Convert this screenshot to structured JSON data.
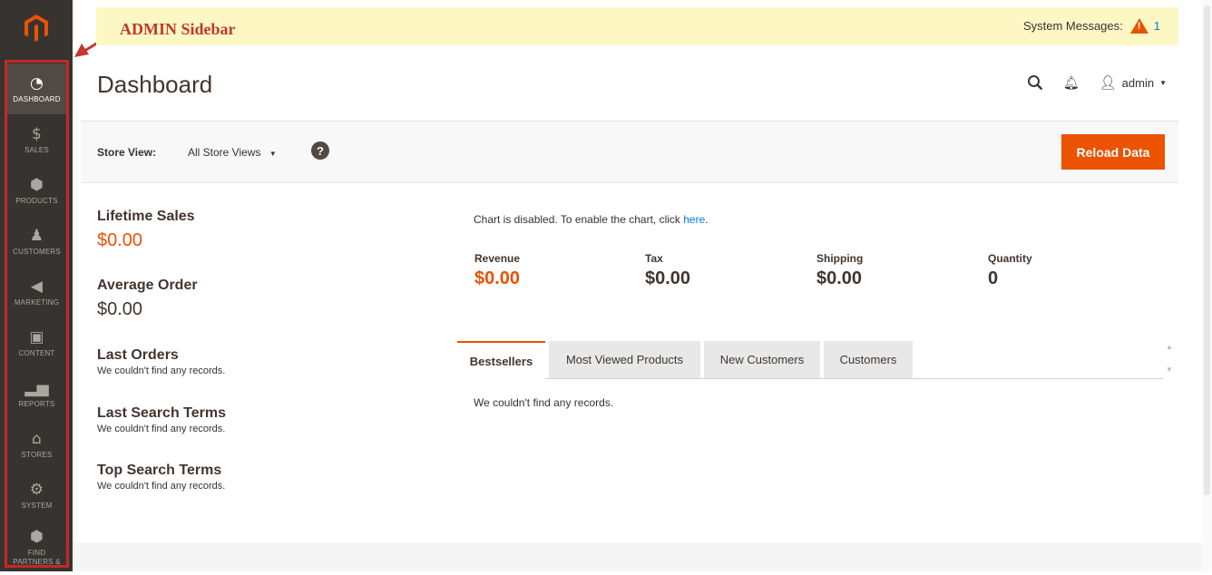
{
  "annotation": {
    "label": "ADMIN Sidebar"
  },
  "system_messages": {
    "label": "System Messages:",
    "count": "1"
  },
  "page_title": "Dashboard",
  "header": {
    "user": "admin"
  },
  "sidebar": {
    "items": [
      {
        "label": "DASHBOARD",
        "icon": "dashboard-gauge-icon",
        "active": true
      },
      {
        "label": "SALES",
        "icon": "dollar-icon"
      },
      {
        "label": "PRODUCTS",
        "icon": "box-icon"
      },
      {
        "label": "CUSTOMERS",
        "icon": "person-icon"
      },
      {
        "label": "MARKETING",
        "icon": "megaphone-icon"
      },
      {
        "label": "CONTENT",
        "icon": "content-layout-icon"
      },
      {
        "label": "REPORTS",
        "icon": "bar-chart-icon"
      },
      {
        "label": "STORES",
        "icon": "storefront-icon"
      },
      {
        "label": "SYSTEM",
        "icon": "gear-icon"
      },
      {
        "label": "FIND PARTNERS &",
        "icon": "partners-box-icon"
      }
    ]
  },
  "store_view": {
    "label": "Store View:",
    "value": "All Store Views"
  },
  "reload_button": "Reload Data",
  "lifetime_sales": {
    "label": "Lifetime Sales",
    "value": "$0.00"
  },
  "average_order": {
    "label": "Average Order",
    "value": "$0.00"
  },
  "last_orders": {
    "title": "Last Orders",
    "empty": "We couldn't find any records."
  },
  "last_search_terms": {
    "title": "Last Search Terms",
    "empty": "We couldn't find any records."
  },
  "top_search_terms": {
    "title": "Top Search Terms",
    "empty": "We couldn't find any records."
  },
  "chart_notice": {
    "text": "Chart is disabled. To enable the chart, click ",
    "link": "here",
    "end": "."
  },
  "totals": [
    {
      "label": "Revenue",
      "value": "$0.00"
    },
    {
      "label": "Tax",
      "value": "$0.00"
    },
    {
      "label": "Shipping",
      "value": "$0.00"
    },
    {
      "label": "Quantity",
      "value": "0"
    }
  ],
  "tabs": [
    {
      "label": "Bestsellers",
      "active": true
    },
    {
      "label": "Most Viewed Products"
    },
    {
      "label": "New Customers"
    },
    {
      "label": "Customers"
    }
  ],
  "tab_empty": "We couldn't find any records.",
  "colors": {
    "accent": "#eb5202",
    "sidebar": "#373330",
    "link": "#007bdb",
    "annotation": "#c0392b"
  }
}
